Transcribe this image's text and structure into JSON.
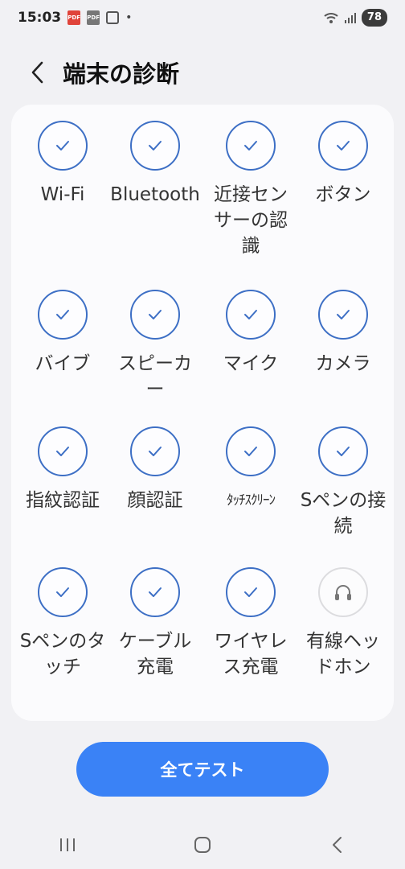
{
  "status_bar": {
    "time": "15:03",
    "battery": "78",
    "dot": "•",
    "pdf_label": "PDF"
  },
  "header": {
    "title": "端末の診断"
  },
  "tests": [
    {
      "label": "Wi-Fi",
      "icon": "check-icon",
      "done": true
    },
    {
      "label": "Bluetooth",
      "icon": "check-icon",
      "done": true
    },
    {
      "label": "近接センサーの認識",
      "icon": "check-icon",
      "done": true
    },
    {
      "label": "ボタン",
      "icon": "check-icon",
      "done": true
    },
    {
      "label": "バイブ",
      "icon": "check-icon",
      "done": true
    },
    {
      "label": "スピーカー",
      "icon": "check-icon",
      "done": true
    },
    {
      "label": "マイク",
      "icon": "check-icon",
      "done": true
    },
    {
      "label": "カメラ",
      "icon": "check-icon",
      "done": true
    },
    {
      "label": "指紋認証",
      "icon": "check-icon",
      "done": true
    },
    {
      "label": "顔認証",
      "icon": "check-icon",
      "done": true
    },
    {
      "label": "ﾀｯﾁｽｸﾘｰﾝ",
      "icon": "check-icon",
      "done": true
    },
    {
      "label": "Sペンの接続",
      "icon": "check-icon",
      "done": true
    },
    {
      "label": "Sペンのタッチ",
      "icon": "check-icon",
      "done": true
    },
    {
      "label": "ケーブル充電",
      "icon": "check-icon",
      "done": true
    },
    {
      "label": "ワイヤレス充電",
      "icon": "check-icon",
      "done": true
    },
    {
      "label": "有線ヘッドホン",
      "icon": "headphones-icon",
      "done": false
    }
  ],
  "actions": {
    "test_all": "全てテスト"
  },
  "colors": {
    "accent": "#3a82f6",
    "check": "#3d6fc5",
    "background": "#f1f1f4",
    "card": "#fbfbfd"
  }
}
